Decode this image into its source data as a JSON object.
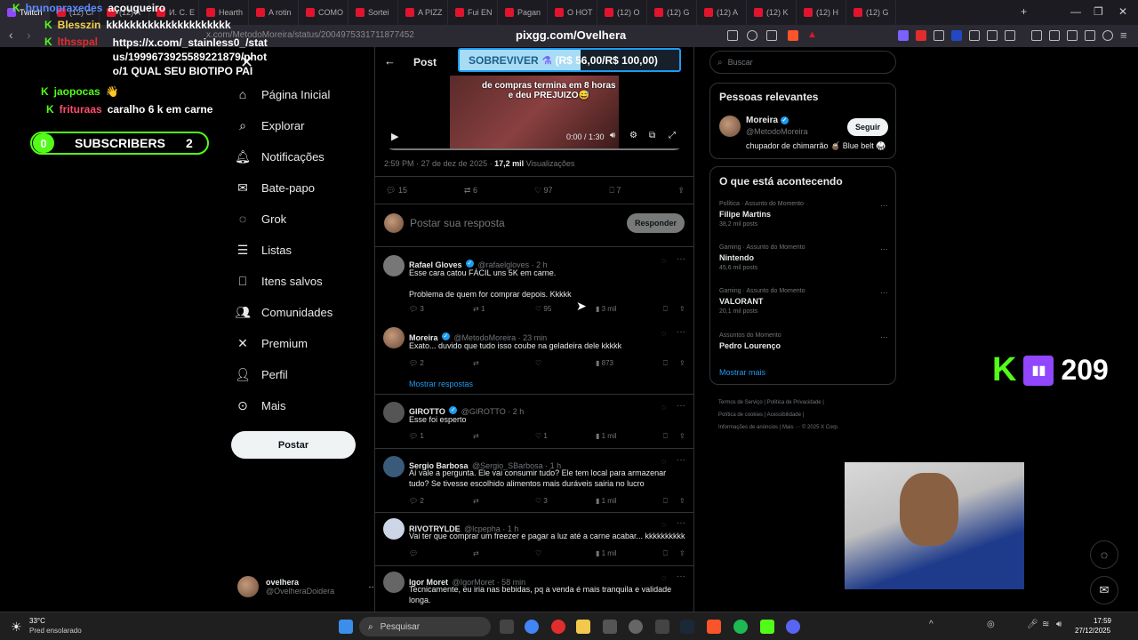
{
  "browser": {
    "tabs": [
      "Twitch",
      "(12) Cl",
      "(12) A",
      "И. С. Е",
      "Hearth",
      "A rotin",
      "COMO",
      "Sortei",
      "A PIZZ",
      "Fui EN",
      "Pagan",
      "O HOT",
      "(12) O",
      "(12) G",
      "(12) A",
      "(12) K",
      "(12) H",
      "(12) G"
    ],
    "url": "x.com/MetodoMoreira/status/2004975331711877452",
    "site_title": "pixgg.com/Ovelhera"
  },
  "chat": [
    {
      "user": "brunopraxedes",
      "msg": "açougueiro",
      "color": "#5b8cff"
    },
    {
      "user": "Blesszin",
      "msg": "kkkkkkkkkkkkkkkkkkkkk",
      "color": "#f2d14b"
    },
    {
      "user": "lthsspal",
      "msg": "https://x.com/_stainless0_/status/1999673925589221879/photo/1 QUAL SEU BIOTIPO PAI",
      "color": "#e22d2d"
    },
    {
      "user": "jaopocas",
      "msg": "👋",
      "color": "#53fc18"
    },
    {
      "user": "frituraas",
      "msg": "caralho 6 k em carne",
      "color": "#ff4d6d"
    }
  ],
  "subs": {
    "left": "0",
    "label": "SUBSCRIBERS",
    "right": "2"
  },
  "donation": {
    "title": "SOBREVIVER",
    "amount": "(R$ 56,00/R$ 100,00)",
    "progress": 0.56
  },
  "nav": [
    "Página Inicial",
    "Explorar",
    "Notificações",
    "Bate-papo",
    "Grok",
    "Listas",
    "Itens salvos",
    "Comunidades",
    "Premium",
    "Perfil",
    "Mais"
  ],
  "post_button": "Postar",
  "me": {
    "name": "ovelhera",
    "handle": "@OvelheraDoidera"
  },
  "header": {
    "title": "Post"
  },
  "video": {
    "caption1": "de compras termina em 8 horas",
    "caption2": "e deu PREJUIZO😅",
    "time": "0:00 / 1:30"
  },
  "tweet": {
    "time": "2:59 PM · 27 de dez de 2025 · ",
    "views": "17,2 mil",
    "views_label": "Visualizações",
    "replies": "15",
    "reposts": "6",
    "likes": "97",
    "bookmarks": "7"
  },
  "compose": {
    "placeholder": "Postar sua resposta",
    "button": "Responder"
  },
  "replies": [
    {
      "name": "Rafael Gloves",
      "handle": "@rafaelgloves · 2 h",
      "text": "Esse cara catou FÁCIL uns 5K em carne.\n\nProblema de quem for comprar depois. Kkkkk",
      "r": "3",
      "rt": "1",
      "l": "95",
      "v": "3 mil"
    },
    {
      "name": "Moreira",
      "handle": "@MetodoMoreira · 23 min",
      "text": "Exato... duvido que tudo isso coube na geladeira dele kkkkk",
      "r": "2",
      "rt": "",
      "l": "",
      "v": "873"
    },
    {
      "name": "GIROTTO",
      "handle": "@GIROTTO · 2 h",
      "text": "Esse foi esperto",
      "r": "1",
      "rt": "",
      "l": "1",
      "v": "1 mil"
    },
    {
      "name": "Sergio Barbosa",
      "handle": "@Sergio_SBarbosa · 1 h",
      "text": "Aí vale a pergunta. Ele vai consumir tudo? Ele tem local para armazenar tudo? Se tivesse escolhido alimentos mais duráveis sairia no lucro",
      "r": "2",
      "rt": "",
      "l": "3",
      "v": "1 mil"
    },
    {
      "name": "RIVOTRYLDE",
      "handle": "@lcpepha · 1 h",
      "text": "Vai ter que comprar um freezer e pagar a luz até a carne acabar... kkkkkkkkkk",
      "r": "",
      "rt": "",
      "l": "",
      "v": "1 mil"
    },
    {
      "name": "Igor Moret",
      "handle": "@IgorMoret · 58 min",
      "text": "Tecnicamente, eu iria nas bebidas, pq a venda é mais tranquila e validade longa.",
      "r": "",
      "rt": "",
      "l": "",
      "v": ""
    }
  ],
  "show_replies": "Mostrar respostas",
  "search": {
    "placeholder": "Buscar"
  },
  "relevant": {
    "title": "Pessoas relevantes",
    "name": "Moreira",
    "handle": "@MetodoMoreira",
    "bio": "chupador de chimarrão 🧉 Blue belt 🥋",
    "follow": "Seguir"
  },
  "trends": {
    "title": "O que está acontecendo",
    "items": [
      {
        "cat": "Política · Assunto do Momento",
        "title": "Filipe Martins",
        "count": "38,2 mil posts"
      },
      {
        "cat": "Gaming · Assunto do Momento",
        "title": "Nintendo",
        "count": "45,6 mil posts"
      },
      {
        "cat": "Gaming · Assunto do Momento",
        "title": "VALORANT",
        "count": "20,1 mil posts"
      },
      {
        "cat": "Assuntos do Momento",
        "title": "Pedro Lourenço",
        "count": ""
      }
    ],
    "more": "Mostrar mais"
  },
  "footer": [
    "Termos de Serviço",
    "Política de Privacidade",
    "Política de cookies",
    "Acessibilidade",
    "Informações de anúncios",
    "Mais ···",
    "© 2025 X Corp."
  ],
  "overlay": {
    "viewers": "209"
  },
  "taskbar": {
    "temp": "33°C",
    "weather": "Pred ensolarado",
    "search": "Pesquisar",
    "time": "17:59",
    "date": "27/12/2025"
  }
}
